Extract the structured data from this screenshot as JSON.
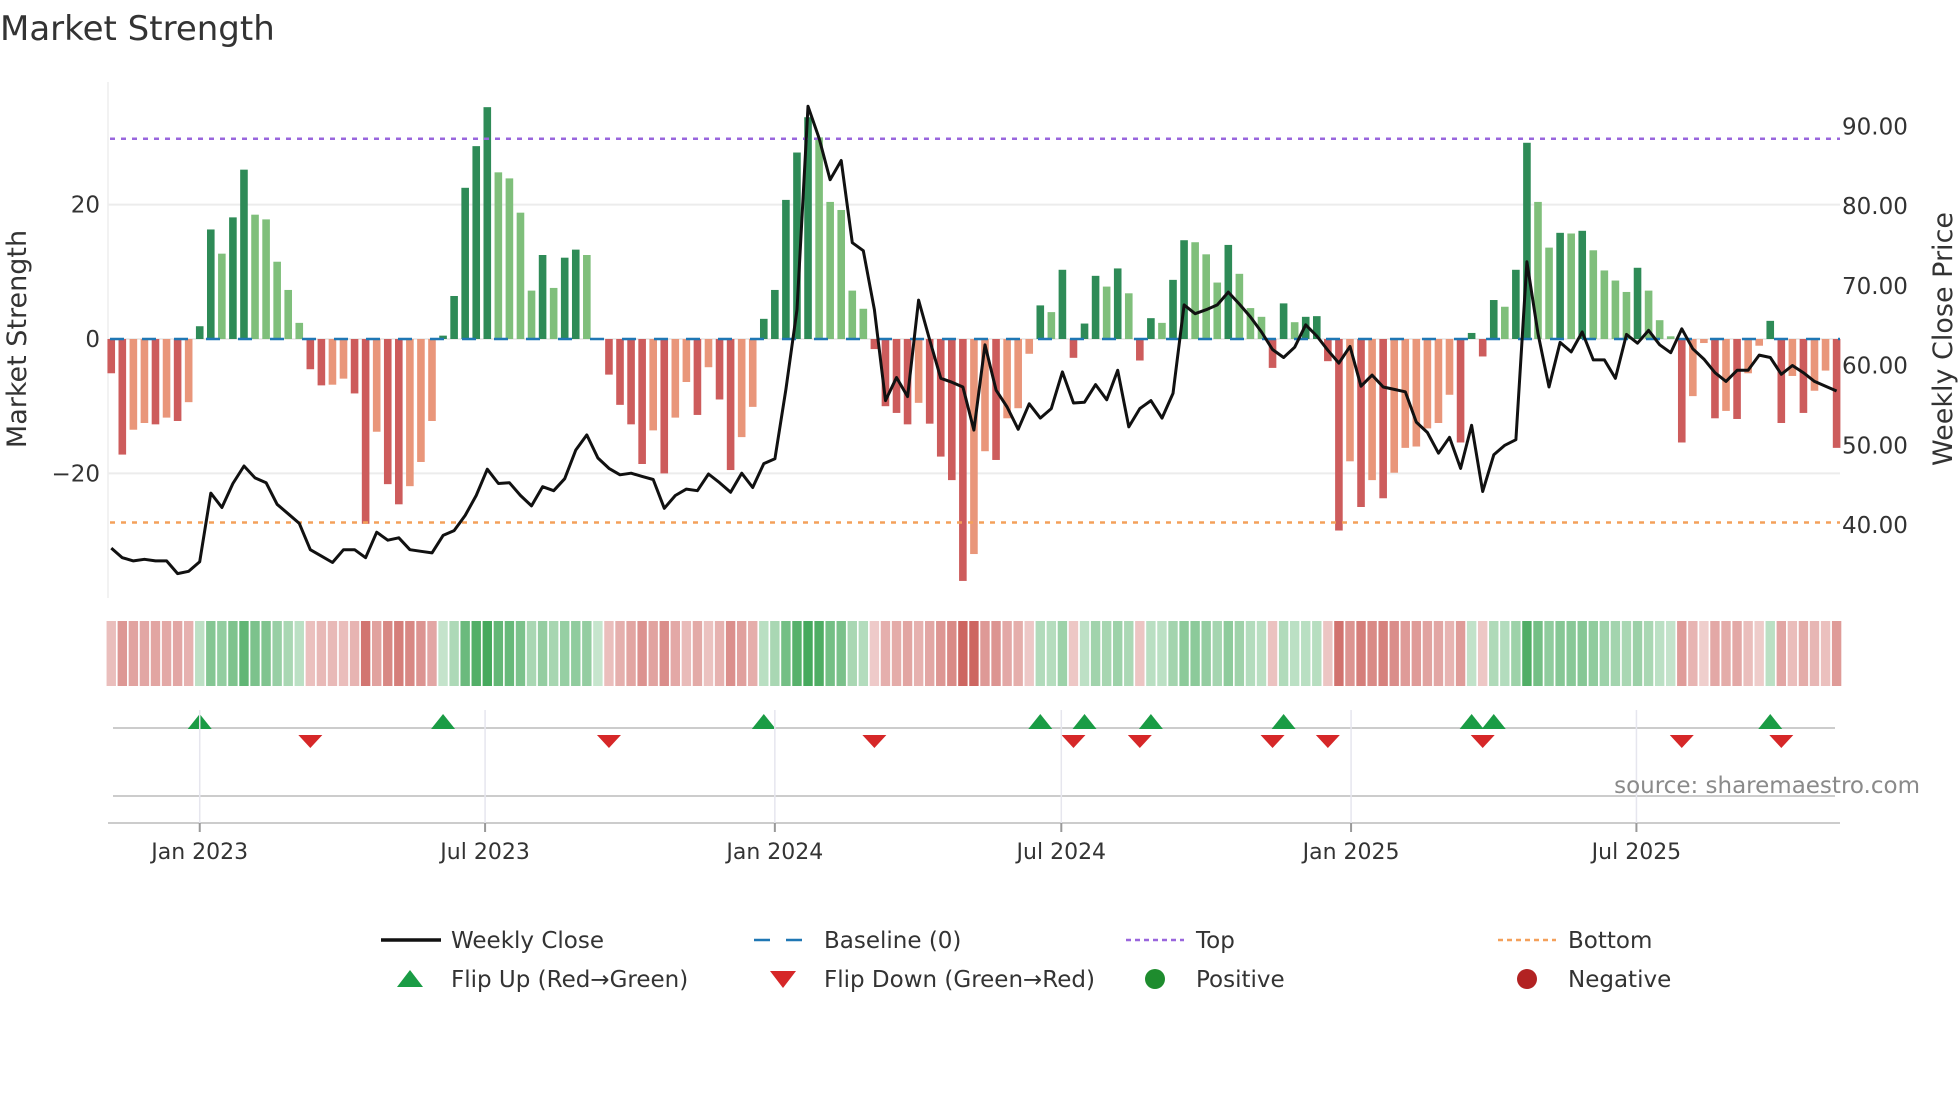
{
  "title": "Market Strength",
  "source": "source: sharemaestro.com",
  "colors": {
    "strong_green": "#2e8b57",
    "weak_green": "#7fbf7b",
    "strong_red": "#cd5c5c",
    "weak_red": "#e9967a",
    "baseline": "#1f77b4",
    "top": "#9966dd",
    "bottom": "#f4a05a",
    "close": "#111111",
    "flip_up": "#1a9c45",
    "flip_down": "#d62728"
  },
  "chart_data": {
    "type": "bar",
    "title": "Market Strength",
    "xlabel": "",
    "ylabel": "Market Strength",
    "y2label": "Weekly Close Price",
    "frequency": "weekly",
    "ylim": [
      -37,
      40
    ],
    "y2lim": [
      31.5,
      95
    ],
    "yticks": [
      {
        "v": 20,
        "label": "20"
      },
      {
        "v": 0,
        "label": "0"
      },
      {
        "v": -20,
        "label": "−20"
      }
    ],
    "y2ticks": [
      {
        "v": 90,
        "label": "90.00"
      },
      {
        "v": 80,
        "label": "80.00"
      },
      {
        "v": 70,
        "label": "70.00"
      },
      {
        "v": 60,
        "label": "60.00"
      },
      {
        "v": 50,
        "label": "50.00"
      },
      {
        "v": 40,
        "label": "40.00"
      }
    ],
    "xticks": [
      {
        "week": 8,
        "label": "Jan 2023"
      },
      {
        "week": 33.8,
        "label": "Jul 2023"
      },
      {
        "week": 60,
        "label": "Jan 2024"
      },
      {
        "week": 85.9,
        "label": "Jul 2024"
      },
      {
        "week": 112.1,
        "label": "Jan 2025"
      },
      {
        "week": 137.9,
        "label": "Jul 2025"
      }
    ],
    "top_level": 29.8,
    "bottom_level": -27.3,
    "baseline": 0,
    "grid": true,
    "legend_placement": "bottom",
    "strength": [
      -5.1,
      -17.2,
      -13.5,
      -12.5,
      -12.7,
      -11.7,
      -12.2,
      -9.4,
      1.9,
      16.3,
      12.7,
      18.1,
      25.2,
      18.5,
      17.8,
      11.5,
      7.3,
      2.4,
      -4.5,
      -6.9,
      -6.8,
      -5.9,
      -8.1,
      -27.5,
      -13.8,
      -21.6,
      -24.6,
      -21.9,
      -18.3,
      -12.2,
      0.5,
      6.4,
      22.5,
      28.7,
      34.5,
      24.8,
      23.9,
      18.8,
      7.2,
      12.5,
      7.6,
      12.1,
      13.3,
      12.5,
      0,
      -5.3,
      -9.8,
      -12.7,
      -18.6,
      -13.6,
      -20,
      -11.7,
      -6.4,
      -11.3,
      -4.2,
      -9,
      -19.5,
      -14.6,
      -10.1,
      3,
      7.3,
      20.7,
      27.75,
      33,
      30,
      20.4,
      19.2,
      7.2,
      4.5,
      -1.5,
      -10,
      -11,
      -12.7,
      -9.5,
      -12.6,
      -17.5,
      -21,
      -36,
      -32,
      -16.7,
      -18,
      -11.8,
      -10.3,
      -2.2,
      5,
      4,
      10.3,
      -2.8,
      2.3,
      9.4,
      7.8,
      10.5,
      6.8,
      -3.2,
      3.1,
      2.4,
      8.8,
      14.7,
      14.4,
      12.6,
      8.4,
      14,
      9.7,
      4.6,
      3.3,
      -4.3,
      5.3,
      2.5,
      3.3,
      3.4,
      -3.3,
      -28.5,
      -18.2,
      -25,
      -21,
      -23.7,
      -19.9,
      -16.2,
      -16,
      -13.3,
      -12.5,
      -8.3,
      -15.4,
      0.9,
      -2.6,
      5.8,
      4.8,
      10.3,
      29.2,
      20.4,
      13.6,
      15.8,
      15.7,
      16.1,
      13.2,
      10.2,
      8.7,
      7,
      10.6,
      7.2,
      2.8,
      0.4,
      -15.4,
      -8.5,
      -0.6,
      -11.8,
      -10.7,
      -11.9,
      -5.1,
      -1,
      2.7,
      -12.5,
      -5.5,
      -11,
      -7.7,
      -4.7,
      -16.2
    ],
    "weekly_close": [
      37.1,
      35.9,
      35.5,
      35.7,
      35.5,
      35.5,
      33.9,
      34.2,
      35.4,
      44.0,
      42.2,
      45.2,
      47.4,
      45.9,
      45.3,
      42.6,
      41.4,
      40.2,
      36.9,
      36.1,
      35.3,
      36.9,
      36.9,
      35.9,
      39.1,
      38.1,
      38.4,
      36.9,
      36.7,
      36.5,
      38.7,
      39.3,
      41.2,
      43.7,
      47.0,
      45.2,
      45.3,
      43.7,
      42.4,
      44.8,
      44.3,
      45.8,
      49.4,
      51.3,
      48.4,
      47.1,
      46.3,
      46.5,
      46.1,
      45.7,
      42.1,
      43.7,
      44.5,
      44.3,
      46.4,
      45.3,
      44.1,
      46.5,
      44.7,
      47.7,
      48.3,
      57,
      67,
      92.5,
      88.5,
      83.3,
      85.7,
      75.4,
      74.4,
      67,
      55.6,
      58.5,
      56.1,
      68.2,
      63.2,
      58.4,
      57.9,
      57.3,
      51.9,
      62.6,
      56.9,
      54.8,
      52,
      55.2,
      53.4,
      54.6,
      59.2,
      55.3,
      55.4,
      57.6,
      55.7,
      59.4,
      52.3,
      54.6,
      55.6,
      53.4,
      56.5,
      67.6,
      66.5,
      67,
      67.6,
      69.2,
      67.7,
      66.1,
      64.2,
      62,
      61,
      62.3,
      65.1,
      63.7,
      61.9,
      60.3,
      62.4,
      57.4,
      58.8,
      57.3,
      57,
      56.7,
      52.9,
      51.6,
      49,
      51,
      47.1,
      52.5,
      44.2,
      48.8,
      50,
      50.7,
      73,
      64,
      57.3,
      62.9,
      61.7,
      64.2,
      60.7,
      60.7,
      58.4,
      63.9,
      62.8,
      64.4,
      62.6,
      61.6,
      64.6,
      62.1,
      60.8,
      59.1,
      58,
      59.4,
      59.4,
      61.3,
      61,
      58.9,
      60,
      59.1,
      58,
      57.4,
      56.8
    ],
    "legend": [
      {
        "key": "close",
        "label": "Weekly Close"
      },
      {
        "key": "baseline",
        "label": "Baseline (0)"
      },
      {
        "key": "top",
        "label": "Top"
      },
      {
        "key": "bottom",
        "label": "Bottom"
      },
      {
        "key": "flip_up",
        "label": "Flip Up (Red→Green)"
      },
      {
        "key": "flip_down",
        "label": "Flip Down (Green→Red)"
      },
      {
        "key": "positive",
        "label": "Positive"
      },
      {
        "key": "negative",
        "label": "Negative"
      }
    ]
  }
}
